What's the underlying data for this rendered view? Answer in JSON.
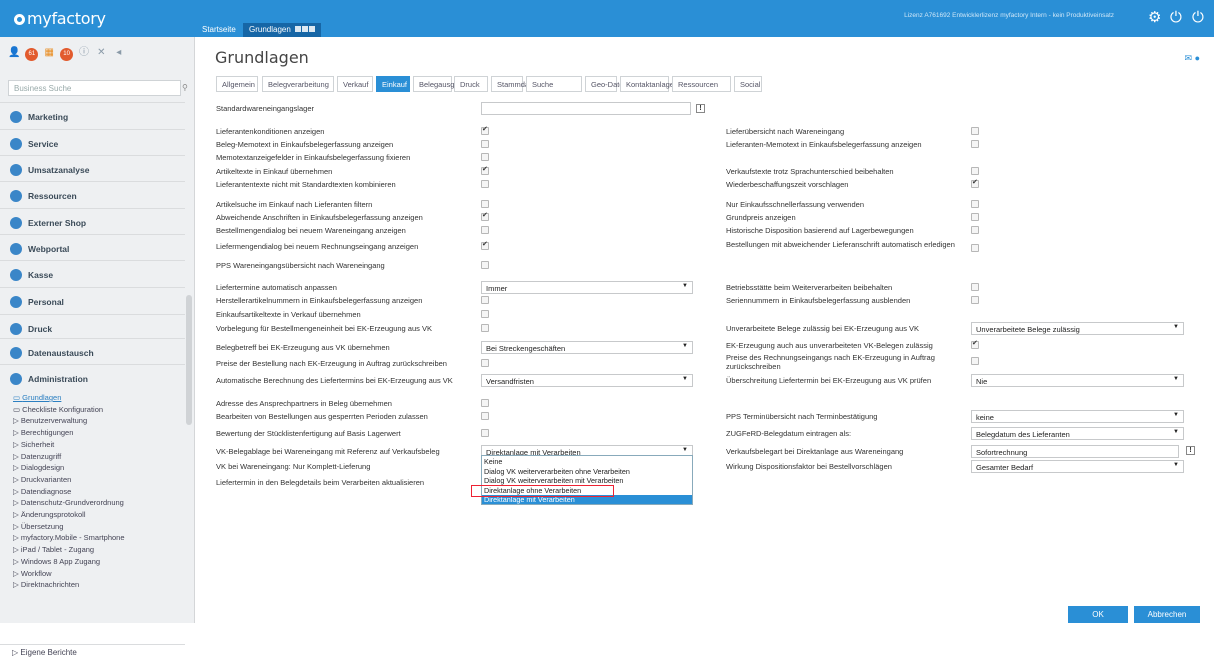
{
  "app": {
    "logo": "myfactory",
    "license": "Lizenz A761692 Entwicklerlizenz myfactory Intern - kein Produktiveinsatz"
  },
  "toptabs": [
    "Startseite",
    "Grundlagen"
  ],
  "icons": {
    "settings": "gear-icon",
    "power": "power-icon",
    "power2": "power-alt-icon",
    "mail": "mail-icon",
    "chat": "chat-icon"
  },
  "sidebar": {
    "quickicons": [
      "person-icon",
      "messages-icon",
      "calendar-icon",
      "notes-icon",
      "info-icon",
      "close-icon",
      "back-icon"
    ],
    "badges": [
      "61",
      "10"
    ],
    "search_placeholder": "Business Suche",
    "sections": [
      "Marketing",
      "Service",
      "Umsatzanalyse",
      "Ressourcen",
      "Externer Shop",
      "Webportal",
      "Kasse",
      "Personal",
      "Druck",
      "Datenaustausch",
      "Administration"
    ],
    "subitems": [
      "Grundlagen",
      "Checkliste Konfiguration",
      "Benutzerverwaltung",
      "Berechtigungen",
      "Sicherheit",
      "Datenzugriff",
      "Dialogdesign",
      "Druckvarianten",
      "Datendiagnose",
      "Datenschutz-Grundverordnung",
      "Änderungsprotokoll",
      "Übersetzung",
      "myfactory.Mobile - Smartphone",
      "iPad / Tablet - Zugang",
      "Windows 8 App Zugang",
      "Workflow",
      "Direktnachrichten"
    ],
    "footer": "Eigene Berichte"
  },
  "page": {
    "title": "Grundlagen"
  },
  "tabs": [
    "Allgemein",
    "Belegverarbeitung",
    "Verkauf",
    "Einkauf",
    "Belegausgabe",
    "Druck",
    "Stammdaten",
    "Suche",
    "Geo-Daten",
    "Kontaktanlage",
    "Ressourcen",
    "Social"
  ],
  "active_tab": "Einkauf",
  "left": {
    "standardlager": "Standardwareneingangslager",
    "rows": [
      {
        "label": "Lieferantenkonditionen anzeigen",
        "checked": true
      },
      {
        "label": "Beleg-Memotext in Einkaufsbelegerfassung anzeigen",
        "checked": false
      },
      {
        "label": "Memotextanzeigefelder in Einkaufsbelegerfassung fixieren",
        "checked": false
      },
      {
        "label": "Artikeltexte in Einkauf übernehmen",
        "checked": true
      },
      {
        "label": "Lieferantentexte nicht mit Standardtexten kombinieren",
        "checked": false
      },
      {
        "label": "Artikelsuche im Einkauf nach Lieferanten filtern",
        "checked": false
      },
      {
        "label": "Abweichende Anschriften in Einkaufsbelegerfassung anzeigen",
        "checked": true
      },
      {
        "label": "Bestellmengendialog bei neuem Wareneingang anzeigen",
        "checked": false
      },
      {
        "label": "Liefermengendialog bei neuem Rechnungseingang anzeigen",
        "checked": true
      },
      {
        "label": "PPS Wareneingangsübersicht nach Wareneingang",
        "checked": false
      },
      {
        "label": "Liefertermine automatisch anpassen",
        "select": "Immer"
      },
      {
        "label": "Herstellerartikelnummern in Einkaufsbelegerfassung anzeigen",
        "checked": false
      },
      {
        "label": "Einkaufsartikeltexte in Verkauf übernehmen",
        "checked": false
      },
      {
        "label": "Vorbelegung für Bestellmengeneinheit bei EK-Erzeugung aus VK",
        "checked": false
      },
      {
        "label": "Belegbetreff bei EK-Erzeugung aus VK übernehmen",
        "select": "Bei Streckengeschäften"
      },
      {
        "label": "Preise der Bestellung nach EK-Erzeugung in Auftrag zurückschreiben",
        "checked": false
      },
      {
        "label": "Automatische Berechnung des Liefertermins bei EK-Erzeugung aus VK",
        "select": "Versandfristen"
      },
      {
        "label": "Adresse des Ansprechpartners in Beleg übernehmen",
        "checked": false
      },
      {
        "label": "Bearbeiten von Bestellungen aus gesperrten Perioden zulassen",
        "checked": false
      },
      {
        "label": "Bewertung der Stücklistenfertigung auf Basis Lagerwert",
        "checked": false
      },
      {
        "label": "VK-Belegablage bei Wareneingang mit Referenz auf Verkaufsbeleg",
        "select": "Direktanlage mit Verarbeiten"
      },
      {
        "label": "VK bei Wareneingang: Nur Komplett-Lieferung",
        "checked": false
      },
      {
        "label": "Liefertermin in den Belegdetails beim Verarbeiten aktualisieren",
        "checked": false
      }
    ]
  },
  "dropdown": {
    "options": [
      "Keine",
      "Dialog VK weiterverarbeiten ohne Verarbeiten",
      "Dialog VK weiterverarbeiten mit Verarbeiten",
      "Direktanlage ohne Verarbeiten",
      "Direktanlage mit Verarbeiten"
    ],
    "highlighted": "Direktanlage mit Verarbeiten"
  },
  "right": {
    "rows": [
      {
        "label": "Lieferübersicht nach Wareneingang",
        "checked": false
      },
      {
        "label": "Lieferanten-Memotext in Einkaufsbelegerfassung anzeigen",
        "checked": false
      },
      {
        "label": "Verkaufstexte trotz Sprachunterschied beibehalten",
        "checked": false
      },
      {
        "label": "Wiederbeschaffungszeit vorschlagen",
        "checked": true
      },
      {
        "label": "Nur Einkaufsschnellerfassung verwenden",
        "checked": false
      },
      {
        "label": "Grundpreis anzeigen",
        "checked": false
      },
      {
        "label": "Historische Disposition basierend auf Lagerbewegungen",
        "checked": false
      },
      {
        "label": "Bestellungen mit abweichender Lieferanschrift automatisch erledigen",
        "checked": false
      },
      {
        "label": "Betriebsstätte beim Weiterverarbeiten beibehalten",
        "checked": false
      },
      {
        "label": "Seriennummern in Einkaufsbelegerfassung ausblenden",
        "checked": false
      },
      {
        "label": "Unverarbeitete Belege zulässig bei EK-Erzeugung aus VK",
        "select": "Unverarbeitete Belege zulässig"
      },
      {
        "label": "EK-Erzeugung auch aus unverarbeiteten VK-Belegen zulässig",
        "checked": true
      },
      {
        "label": "Preise des Rechnungseingangs nach EK-Erzeugung in Auftrag zurückschreiben",
        "checked": false
      },
      {
        "label": "Überschreitung Liefertermin bei EK-Erzeugung aus VK prüfen",
        "select": "Nie"
      },
      {
        "label": "PPS Terminübersicht nach Terminbestätigung",
        "select": "keine"
      },
      {
        "label": "ZUGFeRD-Belegdatum eintragen als:",
        "select": "Belegdatum des Lieferanten"
      },
      {
        "label": "Verkaufsbelegart bei Direktanlage aus Wareneingang",
        "text": "Sofortrechnung"
      },
      {
        "label": "Wirkung Dispositionsfaktor bei Bestellvorschlägen",
        "select": "Gesamter Bedarf"
      }
    ]
  },
  "buttons": {
    "ok": "OK",
    "cancel": "Abbrechen"
  }
}
